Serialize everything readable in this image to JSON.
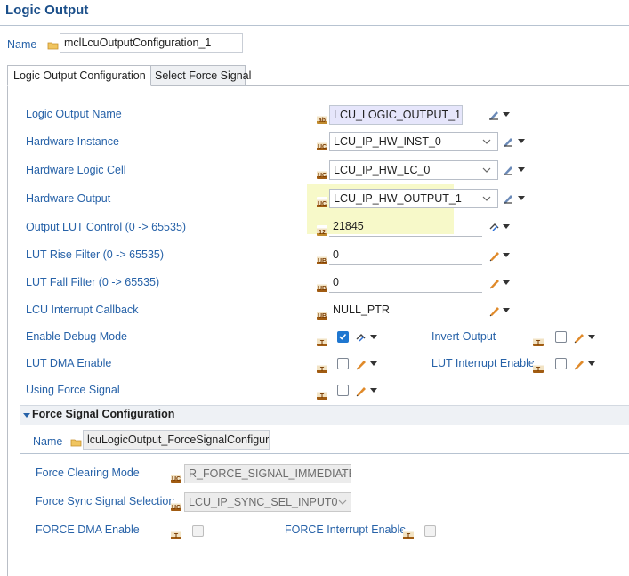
{
  "header": {
    "title": "Logic Output"
  },
  "name_field": {
    "label": "Name",
    "value": "mclLcuOutputConfiguration_1"
  },
  "tabs": [
    {
      "label": "Logic Output Configuration",
      "active": true
    },
    {
      "label": "Select Force Signal",
      "active": false
    }
  ],
  "fields": {
    "logic_output_name": {
      "label": "Logic Output Name",
      "value": "LCU_LOGIC_OUTPUT_1"
    },
    "hardware_instance": {
      "label": "Hardware Instance",
      "value": "LCU_IP_HW_INST_0"
    },
    "hardware_logic_cell": {
      "label": "Hardware Logic Cell",
      "value": "LCU_IP_HW_LC_0"
    },
    "hardware_output": {
      "label": "Hardware Output",
      "value": "LCU_IP_HW_OUTPUT_1"
    },
    "output_lut_control": {
      "label": "Output LUT Control (0 -> 65535)",
      "value": "21845"
    },
    "lut_rise_filter": {
      "label": "LUT Rise Filter (0 -> 65535)",
      "value": "0"
    },
    "lut_fall_filter": {
      "label": "LUT Fall Filter (0 -> 65535)",
      "value": "0"
    },
    "lcu_interrupt_callback": {
      "label": "LCU Interrupt Callback",
      "value": "NULL_PTR"
    },
    "enable_debug_mode": {
      "label": "Enable Debug Mode",
      "checked": true
    },
    "invert_output": {
      "label": "Invert Output",
      "checked": false
    },
    "lut_dma_enable": {
      "label": "LUT DMA Enable",
      "checked": false
    },
    "lut_interrupt_enable": {
      "label": "LUT Interrupt Enable",
      "checked": false
    },
    "using_force_signal": {
      "label": "Using Force Signal",
      "checked": false
    }
  },
  "force_section": {
    "title": "Force Signal Configuration",
    "name_label": "Name",
    "name_value": "lcuLogicOutput_ForceSignalConfigurati",
    "force_clearing_mode": {
      "label": "Force Clearing Mode",
      "value": "R_FORCE_SIGNAL_IMMEDIATE"
    },
    "force_sync_signal_selection": {
      "label": "Force Sync Signal Selection",
      "value": "LCU_IP_SYNC_SEL_INPUT0"
    },
    "force_dma_enable": {
      "label": "FORCE DMA Enable",
      "checked": false
    },
    "force_interrupt_enable": {
      "label": "FORCE Interrupt Enable",
      "checked": false
    }
  },
  "icons": {
    "type_icon_text": "UC",
    "type_icon_text_b": "UB"
  },
  "colors": {
    "label_blue": "#2762a8",
    "title_blue": "#1b4f8a",
    "highlight": "#f7f9c9",
    "checkbox_checked": "#1f77d0"
  }
}
